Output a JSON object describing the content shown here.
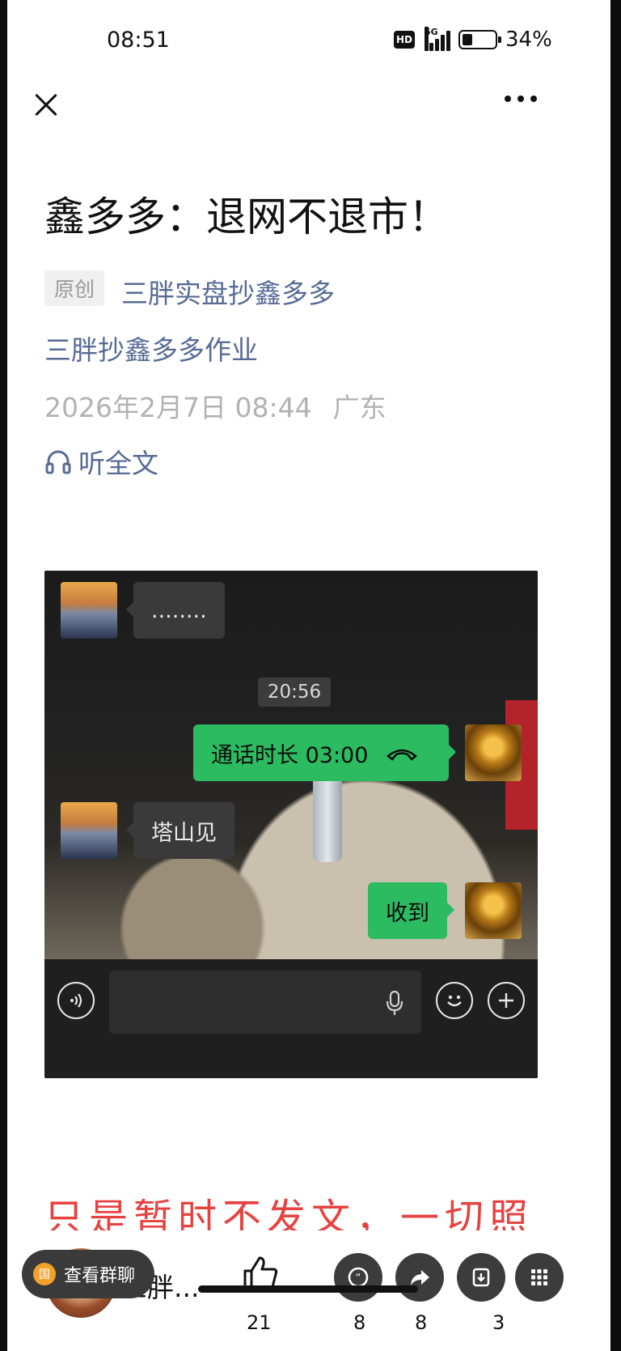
{
  "status_bar": {
    "time": "08:51",
    "hd": "HD",
    "network": "5G",
    "battery": "34%",
    "battery_level": 0.34
  },
  "top_bar": {
    "close_icon": "close-icon",
    "more_icon": "more-icon"
  },
  "article": {
    "title": "鑫多多：退网不退市！",
    "original_badge": "原创",
    "author": "三胖实盘抄鑫多多",
    "series": "三胖抄鑫多多作业",
    "date": "2026年2月7日 08:44",
    "location": "广东",
    "listen_label": "听全文",
    "highlight_text": "只是暂时不发文，一切照"
  },
  "chat_image": {
    "msg1": "........",
    "timestamp": "20:56",
    "call_label": "通话时长 03:00",
    "msg2": "塔山见",
    "msg3": "收到",
    "icons": [
      "voice-icon",
      "mic-icon",
      "emoji-icon",
      "plus-icon"
    ]
  },
  "bottom_bar": {
    "group_chat_label": "查看群聊",
    "group_flag": "国",
    "author_short": "三胖...",
    "like_count": "21",
    "comment_count": "8",
    "share_count": "8",
    "favorite_count": "3"
  }
}
